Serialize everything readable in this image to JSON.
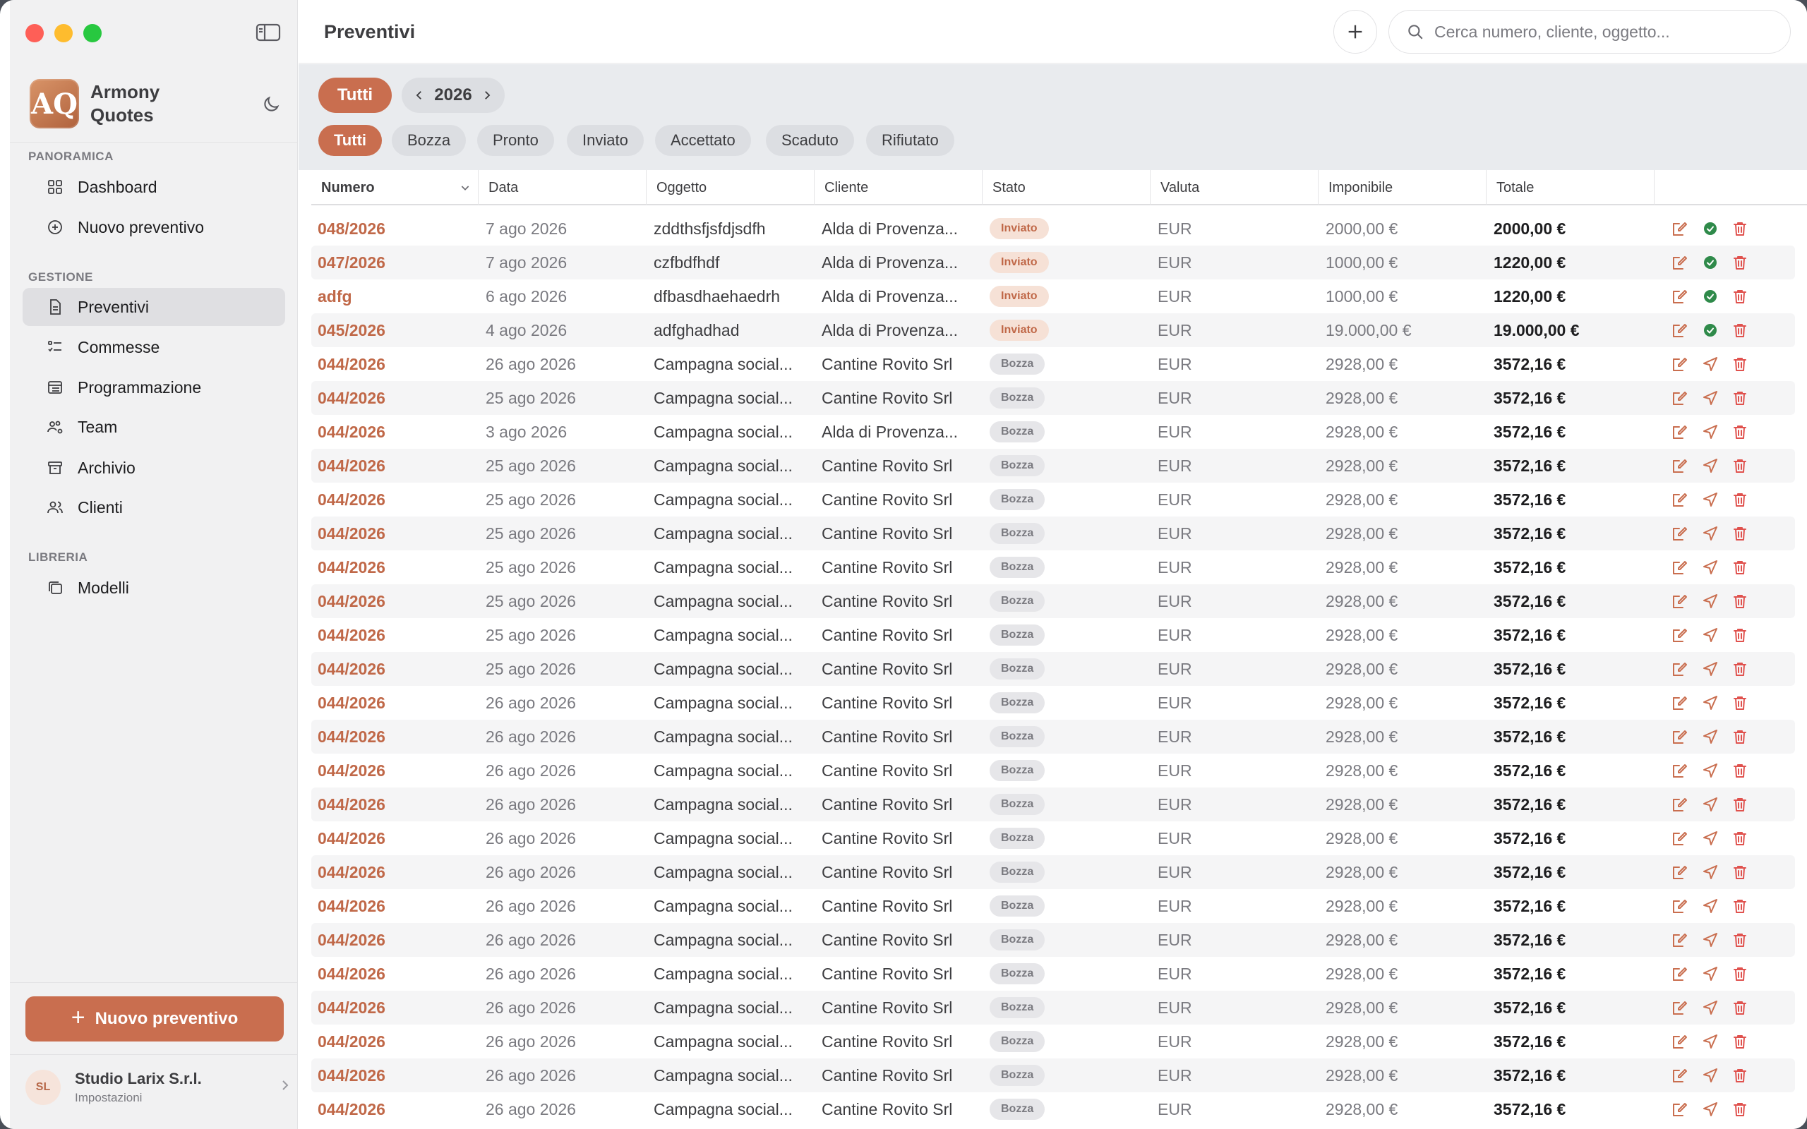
{
  "app": {
    "name": "Armony Quotes",
    "logo_text": "AQ"
  },
  "sidebar": {
    "sections": [
      {
        "label": "PANORAMICA",
        "items": [
          {
            "label": "Dashboard",
            "icon": "grid-icon"
          },
          {
            "label": "Nuovo preventivo",
            "icon": "plus-circle-icon"
          }
        ]
      },
      {
        "label": "GESTIONE",
        "items": [
          {
            "label": "Preventivi",
            "icon": "document-icon",
            "active": true
          },
          {
            "label": "Commesse",
            "icon": "checklist-icon"
          },
          {
            "label": "Programmazione",
            "icon": "calendar-list-icon"
          },
          {
            "label": "Team",
            "icon": "team-gear-icon"
          },
          {
            "label": "Archivio",
            "icon": "archive-box-icon"
          },
          {
            "label": "Clienti",
            "icon": "people-icon"
          }
        ]
      },
      {
        "label": "LIBRERIA",
        "items": [
          {
            "label": "Modelli",
            "icon": "stack-icon"
          }
        ]
      }
    ],
    "new_button_label": "Nuovo preventivo",
    "account": {
      "initials": "SL",
      "name": "Studio Larix S.r.l.",
      "subtitle": "Impostazioni"
    }
  },
  "header": {
    "title": "Preventivi",
    "search_placeholder": "Cerca numero, cliente, oggetto..."
  },
  "filters": {
    "period_all": "Tutti",
    "year": "2026",
    "status_tabs": [
      "Tutti",
      "Bozza",
      "Pronto",
      "Inviato",
      "Accettato",
      "Scaduto",
      "Rifiutato"
    ],
    "active_status": "Tutti"
  },
  "colors": {
    "accent": "#c96e4f",
    "sent_check": "#2f8a4a",
    "delete": "#e0524e"
  },
  "table": {
    "columns": [
      "Numero",
      "Data",
      "Oggetto",
      "Cliente",
      "Stato",
      "Valuta",
      "Imponibile",
      "Totale"
    ],
    "rows": [
      {
        "numero": "048/2026",
        "data": "7 ago 2026",
        "oggetto": "zddthsfjsfdjsdfh",
        "cliente": "Alda di Provenza...",
        "stato": "Inviato",
        "valuta": "EUR",
        "imponibile": "2000,00 €",
        "totale": "2000,00 €"
      },
      {
        "numero": "047/2026",
        "data": "7 ago 2026",
        "oggetto": "czfbdfhdf",
        "cliente": "Alda di Provenza...",
        "stato": "Inviato",
        "valuta": "EUR",
        "imponibile": "1000,00 €",
        "totale": "1220,00 €"
      },
      {
        "numero": "adfg",
        "data": "6 ago 2026",
        "oggetto": "dfbasdhaehaedrh",
        "cliente": "Alda di Provenza...",
        "stato": "Inviato",
        "valuta": "EUR",
        "imponibile": "1000,00 €",
        "totale": "1220,00 €"
      },
      {
        "numero": "045/2026",
        "data": "4 ago 2026",
        "oggetto": "adfghadhad",
        "cliente": "Alda di Provenza...",
        "stato": "Inviato",
        "valuta": "EUR",
        "imponibile": "19.000,00 €",
        "totale": "19.000,00 €"
      },
      {
        "numero": "044/2026",
        "data": "26 ago 2026",
        "oggetto": "Campagna social...",
        "cliente": "Cantine Rovito Srl",
        "stato": "Bozza",
        "valuta": "EUR",
        "imponibile": "2928,00 €",
        "totale": "3572,16 €"
      },
      {
        "numero": "044/2026",
        "data": "25 ago 2026",
        "oggetto": "Campagna social...",
        "cliente": "Cantine Rovito Srl",
        "stato": "Bozza",
        "valuta": "EUR",
        "imponibile": "2928,00 €",
        "totale": "3572,16 €"
      },
      {
        "numero": "044/2026",
        "data": "3 ago 2026",
        "oggetto": "Campagna social...",
        "cliente": "Alda di Provenza...",
        "stato": "Bozza",
        "valuta": "EUR",
        "imponibile": "2928,00 €",
        "totale": "3572,16 €"
      },
      {
        "numero": "044/2026",
        "data": "25 ago 2026",
        "oggetto": "Campagna social...",
        "cliente": "Cantine Rovito Srl",
        "stato": "Bozza",
        "valuta": "EUR",
        "imponibile": "2928,00 €",
        "totale": "3572,16 €"
      },
      {
        "numero": "044/2026",
        "data": "25 ago 2026",
        "oggetto": "Campagna social...",
        "cliente": "Cantine Rovito Srl",
        "stato": "Bozza",
        "valuta": "EUR",
        "imponibile": "2928,00 €",
        "totale": "3572,16 €"
      },
      {
        "numero": "044/2026",
        "data": "25 ago 2026",
        "oggetto": "Campagna social...",
        "cliente": "Cantine Rovito Srl",
        "stato": "Bozza",
        "valuta": "EUR",
        "imponibile": "2928,00 €",
        "totale": "3572,16 €"
      },
      {
        "numero": "044/2026",
        "data": "25 ago 2026",
        "oggetto": "Campagna social...",
        "cliente": "Cantine Rovito Srl",
        "stato": "Bozza",
        "valuta": "EUR",
        "imponibile": "2928,00 €",
        "totale": "3572,16 €"
      },
      {
        "numero": "044/2026",
        "data": "25 ago 2026",
        "oggetto": "Campagna social...",
        "cliente": "Cantine Rovito Srl",
        "stato": "Bozza",
        "valuta": "EUR",
        "imponibile": "2928,00 €",
        "totale": "3572,16 €"
      },
      {
        "numero": "044/2026",
        "data": "25 ago 2026",
        "oggetto": "Campagna social...",
        "cliente": "Cantine Rovito Srl",
        "stato": "Bozza",
        "valuta": "EUR",
        "imponibile": "2928,00 €",
        "totale": "3572,16 €"
      },
      {
        "numero": "044/2026",
        "data": "25 ago 2026",
        "oggetto": "Campagna social...",
        "cliente": "Cantine Rovito Srl",
        "stato": "Bozza",
        "valuta": "EUR",
        "imponibile": "2928,00 €",
        "totale": "3572,16 €"
      },
      {
        "numero": "044/2026",
        "data": "26 ago 2026",
        "oggetto": "Campagna social...",
        "cliente": "Cantine Rovito Srl",
        "stato": "Bozza",
        "valuta": "EUR",
        "imponibile": "2928,00 €",
        "totale": "3572,16 €"
      },
      {
        "numero": "044/2026",
        "data": "26 ago 2026",
        "oggetto": "Campagna social...",
        "cliente": "Cantine Rovito Srl",
        "stato": "Bozza",
        "valuta": "EUR",
        "imponibile": "2928,00 €",
        "totale": "3572,16 €"
      },
      {
        "numero": "044/2026",
        "data": "26 ago 2026",
        "oggetto": "Campagna social...",
        "cliente": "Cantine Rovito Srl",
        "stato": "Bozza",
        "valuta": "EUR",
        "imponibile": "2928,00 €",
        "totale": "3572,16 €"
      },
      {
        "numero": "044/2026",
        "data": "26 ago 2026",
        "oggetto": "Campagna social...",
        "cliente": "Cantine Rovito Srl",
        "stato": "Bozza",
        "valuta": "EUR",
        "imponibile": "2928,00 €",
        "totale": "3572,16 €"
      },
      {
        "numero": "044/2026",
        "data": "26 ago 2026",
        "oggetto": "Campagna social...",
        "cliente": "Cantine Rovito Srl",
        "stato": "Bozza",
        "valuta": "EUR",
        "imponibile": "2928,00 €",
        "totale": "3572,16 €"
      },
      {
        "numero": "044/2026",
        "data": "26 ago 2026",
        "oggetto": "Campagna social...",
        "cliente": "Cantine Rovito Srl",
        "stato": "Bozza",
        "valuta": "EUR",
        "imponibile": "2928,00 €",
        "totale": "3572,16 €"
      },
      {
        "numero": "044/2026",
        "data": "26 ago 2026",
        "oggetto": "Campagna social...",
        "cliente": "Cantine Rovito Srl",
        "stato": "Bozza",
        "valuta": "EUR",
        "imponibile": "2928,00 €",
        "totale": "3572,16 €"
      },
      {
        "numero": "044/2026",
        "data": "26 ago 2026",
        "oggetto": "Campagna social...",
        "cliente": "Cantine Rovito Srl",
        "stato": "Bozza",
        "valuta": "EUR",
        "imponibile": "2928,00 €",
        "totale": "3572,16 €"
      },
      {
        "numero": "044/2026",
        "data": "26 ago 2026",
        "oggetto": "Campagna social...",
        "cliente": "Cantine Rovito Srl",
        "stato": "Bozza",
        "valuta": "EUR",
        "imponibile": "2928,00 €",
        "totale": "3572,16 €"
      },
      {
        "numero": "044/2026",
        "data": "26 ago 2026",
        "oggetto": "Campagna social...",
        "cliente": "Cantine Rovito Srl",
        "stato": "Bozza",
        "valuta": "EUR",
        "imponibile": "2928,00 €",
        "totale": "3572,16 €"
      },
      {
        "numero": "044/2026",
        "data": "26 ago 2026",
        "oggetto": "Campagna social...",
        "cliente": "Cantine Rovito Srl",
        "stato": "Bozza",
        "valuta": "EUR",
        "imponibile": "2928,00 €",
        "totale": "3572,16 €"
      },
      {
        "numero": "044/2026",
        "data": "26 ago 2026",
        "oggetto": "Campagna social...",
        "cliente": "Cantine Rovito Srl",
        "stato": "Bozza",
        "valuta": "EUR",
        "imponibile": "2928,00 €",
        "totale": "3572,16 €"
      },
      {
        "numero": "044/2026",
        "data": "26 ago 2026",
        "oggetto": "Campagna social...",
        "cliente": "Cantine Rovito Srl",
        "stato": "Bozza",
        "valuta": "EUR",
        "imponibile": "2928,00 €",
        "totale": "3572,16 €"
      }
    ]
  }
}
